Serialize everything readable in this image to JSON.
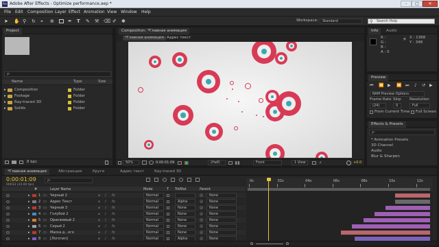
{
  "window": {
    "title": "Adobe After Effects - Optimize performance.aep *"
  },
  "menu": [
    "File",
    "Edit",
    "Composition",
    "Layer",
    "Effect",
    "Animation",
    "View",
    "Window",
    "Help"
  ],
  "toolbar": {
    "workspace_label": "Workspace:",
    "workspace_value": "Standard",
    "search_placeholder": "Search Help"
  },
  "project": {
    "tab": "Project",
    "search_placeholder": "ρ-",
    "columns": [
      "Name",
      "Type",
      "Size"
    ],
    "items": [
      {
        "name": "Composition",
        "type": "Folder"
      },
      {
        "name": "Footage",
        "type": "Folder"
      },
      {
        "name": "Ray-traced 3D",
        "type": "Folder"
      },
      {
        "name": "Solids",
        "type": "Folder"
      }
    ],
    "bpc": "8 bpc"
  },
  "composition": {
    "tab": "Composition: *Главная анимация",
    "subtab": "*Главная анимация",
    "crumb": "Адрес текст",
    "zoom": "50%",
    "timecode": "0:00:01:09",
    "resolution": "(Half)",
    "view": "Front",
    "views": "1 View",
    "exposure": "+0.0"
  },
  "info": {
    "tab": "Info",
    "tab2": "Audio",
    "x": "X : 1368",
    "y": "Y : 348",
    "r": "R :",
    "g": "G :",
    "b": "B :",
    "a": "A : 0"
  },
  "preview": {
    "tab": "Preview",
    "ram_label": "RAM Preview Options",
    "frame_rate_label": "Frame Rate",
    "skip_label": "Skip",
    "resolution_label": "Resolution",
    "frame_rate_value": "(24)",
    "skip_value": "0",
    "resolution_value": "Full",
    "from_current": "From Current Time",
    "full_screen": "Full Screen"
  },
  "effects": {
    "tab": "Effects & Presets",
    "search_placeholder": "ρ-",
    "items": [
      "* Animation Presets",
      "3D Channel",
      "Audio",
      "Blur & Sharpen"
    ]
  },
  "timeline": {
    "tabs": [
      "*Главная анимация",
      "Абстракция",
      "Круги",
      "Адрес текст",
      "Ray-traced 3D"
    ],
    "timecode": "0:00:01:09",
    "timecode_sub": "00033 (24.00 fps)",
    "search_placeholder": "ρ-",
    "columns": {
      "num": "#",
      "layer": "Layer Name",
      "mode": "Mode",
      "t": "T",
      "trkmat": "TrkMat",
      "parent": "Parent"
    },
    "ruler": [
      "0s",
      "02s",
      "04s",
      "06s",
      "08s",
      "10s",
      "12s"
    ],
    "layers": [
      {
        "num": "1",
        "name": "Черный 2",
        "color": "#c0392b",
        "mode": "Normal",
        "trkmat": "",
        "parent": "None"
      },
      {
        "num": "2",
        "name": "Адрес Текст",
        "color": "#7d7d7d",
        "mode": "Normal",
        "trkmat": "Alpha",
        "parent": "None"
      },
      {
        "num": "3",
        "name": "Черный 3",
        "color": "#c0392b",
        "mode": "Normal",
        "trkmat": "None",
        "parent": "None"
      },
      {
        "num": "4",
        "name": "Голубой 2",
        "color": "#3f8fc9",
        "mode": "Normal",
        "trkmat": "None",
        "parent": "None"
      },
      {
        "num": "5",
        "name": "Оранжевый 2",
        "color": "#e07b2a",
        "mode": "Normal",
        "trkmat": "None",
        "parent": "None"
      },
      {
        "num": "6",
        "name": "Серый 2",
        "color": "#a0a0a0",
        "mode": "Normal",
        "trkmat": "None",
        "parent": "None"
      },
      {
        "num": "7",
        "name": "Маска д...ого",
        "color": "#c0392b",
        "mode": "Normal",
        "trkmat": "None",
        "parent": "None"
      },
      {
        "num": "8",
        "name": "[Логотип]",
        "color": "#7d5cc9",
        "mode": "Normal",
        "trkmat": "Alpha",
        "parent": "None"
      }
    ],
    "bars": [
      {
        "start": 10.5,
        "end": 13.0,
        "color": "#b9666c"
      },
      {
        "start": 10.5,
        "end": 13.0,
        "color": "#6a6a6a"
      },
      {
        "start": 9.8,
        "end": 13.0,
        "color": "#a05fb5"
      },
      {
        "start": 9.0,
        "end": 13.0,
        "color": "#a05fb5"
      },
      {
        "start": 8.2,
        "end": 13.0,
        "color": "#a05fb5"
      },
      {
        "start": 7.4,
        "end": 13.0,
        "color": "#a05fb5"
      },
      {
        "start": 6.6,
        "end": 13.0,
        "color": "#b9666c"
      },
      {
        "start": 7.6,
        "end": 13.0,
        "color": "#7c62b8"
      }
    ],
    "playhead": 1.4
  },
  "colors": {
    "accent": "#e8c43a",
    "ring": "#d83a55",
    "ring_center": "#3aa8b2"
  }
}
